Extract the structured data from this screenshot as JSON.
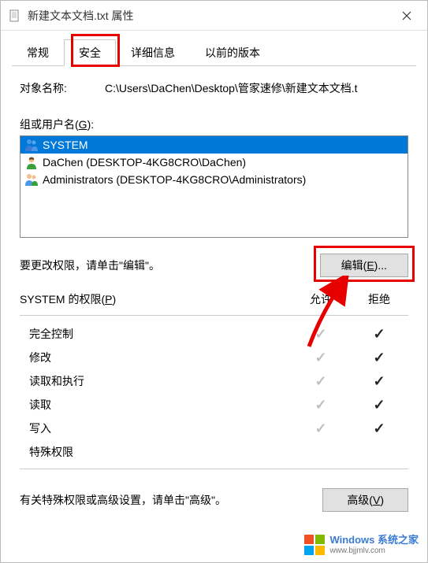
{
  "titlebar": {
    "title": "新建文本文档.txt 属性"
  },
  "tabs": [
    {
      "label": "常规",
      "active": false
    },
    {
      "label": "安全",
      "active": true
    },
    {
      "label": "详细信息",
      "active": false
    },
    {
      "label": "以前的版本",
      "active": false
    }
  ],
  "object": {
    "label": "对象名称:",
    "value": "C:\\Users\\DaChen\\Desktop\\管家速修\\新建文本文档.t"
  },
  "group_label_pre": "组或用户名(",
  "group_label_key": "G",
  "group_label_post": "):",
  "users": [
    {
      "name": "SYSTEM",
      "type": "group",
      "selected": true
    },
    {
      "name": "DaChen (DESKTOP-4KG8CRO\\DaChen)",
      "type": "user",
      "selected": false
    },
    {
      "name": "Administrators (DESKTOP-4KG8CRO\\Administrators)",
      "type": "group",
      "selected": false
    }
  ],
  "edit_hint": "要更改权限，请单击\"编辑\"。",
  "edit_button_pre": "编辑(",
  "edit_button_key": "E",
  "edit_button_post": ")...",
  "perm_header_pre": "SYSTEM 的权限(",
  "perm_header_key": "P",
  "perm_header_post": ")",
  "perm_allow": "允许",
  "perm_deny": "拒绝",
  "permissions": [
    {
      "label": "完全控制",
      "allow": "light",
      "deny": "dark"
    },
    {
      "label": "修改",
      "allow": "light",
      "deny": "dark"
    },
    {
      "label": "读取和执行",
      "allow": "light",
      "deny": "dark"
    },
    {
      "label": "读取",
      "allow": "light",
      "deny": "dark"
    },
    {
      "label": "写入",
      "allow": "light",
      "deny": "dark"
    },
    {
      "label": "特殊权限",
      "allow": "",
      "deny": ""
    }
  ],
  "adv_hint": "有关特殊权限或高级设置，请单击\"高级\"。",
  "adv_button_pre": "高级(",
  "adv_button_key": "V",
  "adv_button_post": ")",
  "watermark": {
    "brand": "Windows 系统之家",
    "url": "www.bjjmlv.com"
  }
}
